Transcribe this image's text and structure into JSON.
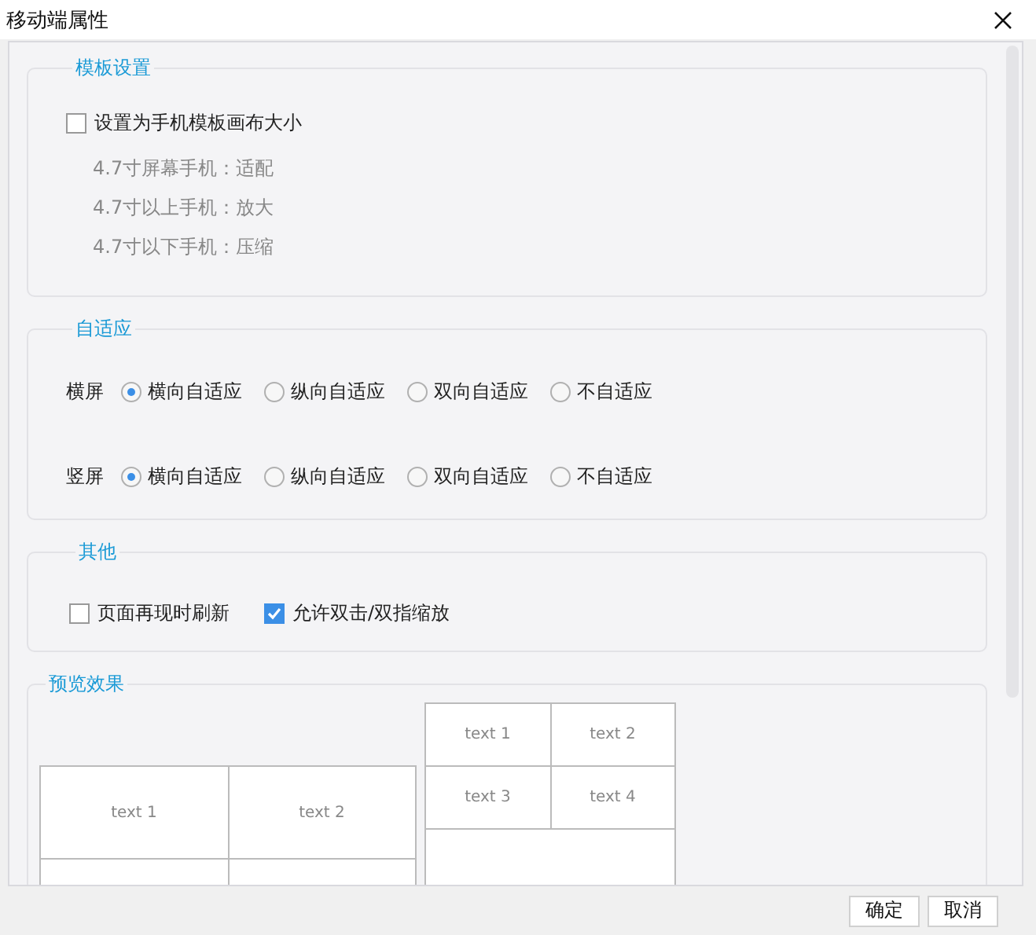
{
  "window": {
    "title": "移动端属性"
  },
  "template_settings": {
    "legend": "模板设置",
    "checkbox": {
      "label": "设置为手机模板画布大小",
      "checked": false
    },
    "notes": [
      "4.7寸屏幕手机：适配",
      "4.7寸以上手机：放大",
      "4.7寸以下手机：压缩"
    ]
  },
  "adaptive": {
    "legend": "自适应",
    "rows": [
      {
        "label": "横屏",
        "options": [
          {
            "label": "横向自适应",
            "selected": true
          },
          {
            "label": "纵向自适应",
            "selected": false
          },
          {
            "label": "双向自适应",
            "selected": false
          },
          {
            "label": "不自适应",
            "selected": false
          }
        ]
      },
      {
        "label": "竖屏",
        "options": [
          {
            "label": "横向自适应",
            "selected": true
          },
          {
            "label": "纵向自适应",
            "selected": false
          },
          {
            "label": "双向自适应",
            "selected": false
          },
          {
            "label": "不自适应",
            "selected": false
          }
        ]
      }
    ]
  },
  "other": {
    "legend": "其他",
    "checkboxes": [
      {
        "label": "页面再现时刷新",
        "checked": false
      },
      {
        "label": "允许双击/双指缩放",
        "checked": true
      }
    ]
  },
  "preview": {
    "legend": "预览效果",
    "phone_table": [
      [
        "text 1",
        "text 2"
      ]
    ],
    "tablet_table": [
      [
        "text 1",
        "text 2"
      ],
      [
        "text 3",
        "text 4"
      ]
    ]
  },
  "buttons": [
    "确定",
    "取消"
  ]
}
